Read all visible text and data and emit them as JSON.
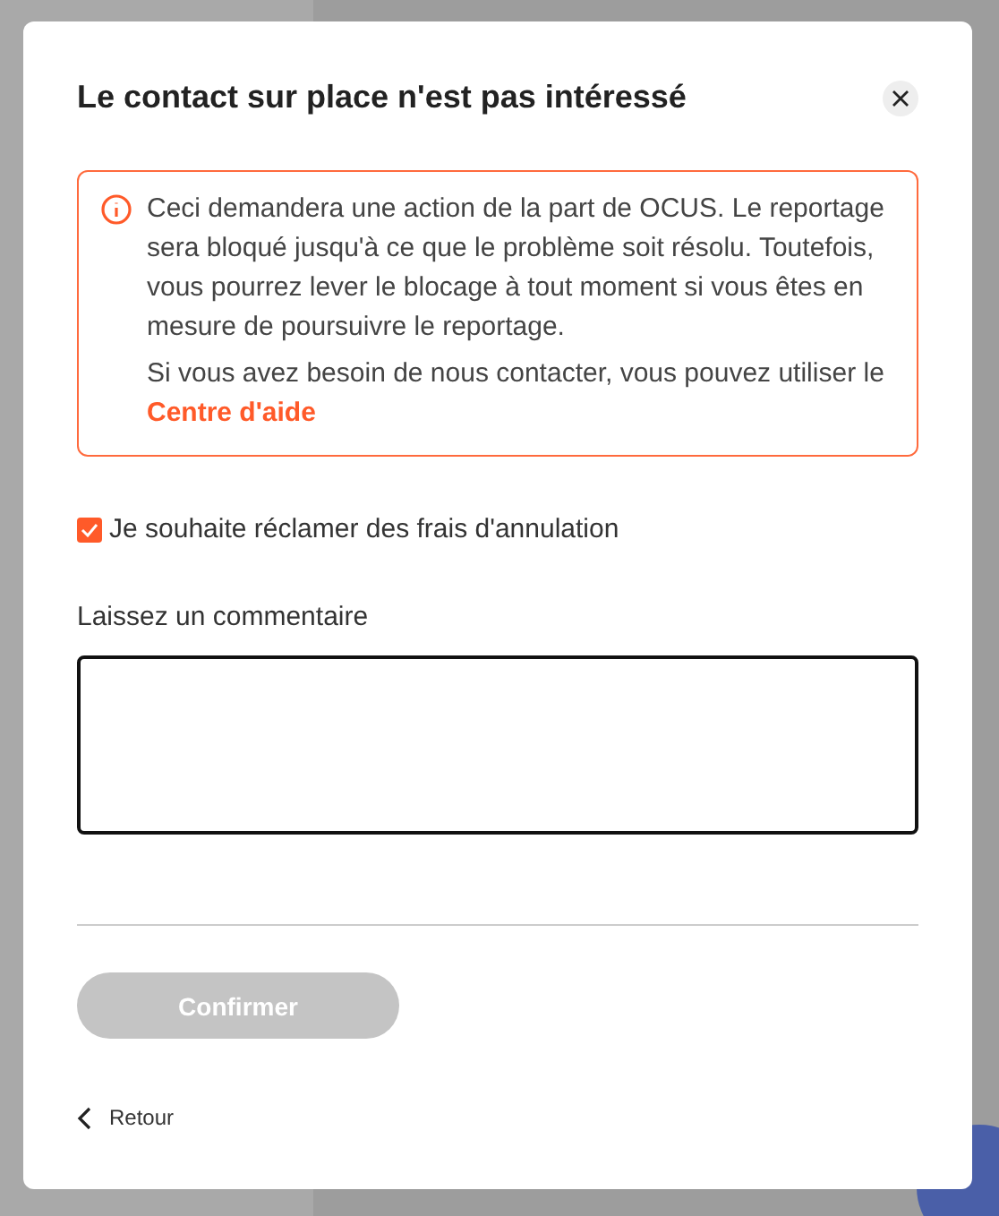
{
  "dialog": {
    "title": "Le contact sur place n'est pas intéressé",
    "alert": {
      "lines": [
        "Ceci demandera une action de la part de OCUS. Le reportage sera bloqué jusqu'à ce que le problème soit résolu. Toutefois, vous pourrez lever le blocage à tout moment si vous êtes en mesure de poursuivre le reportage.",
        "Si vous avez besoin de nous contacter, vous pouvez utiliser le"
      ],
      "link": "Centre d'aide"
    },
    "checkbox": {
      "label": "Je souhaite réclamer des frais d'annulation",
      "checked": true
    },
    "comment": {
      "label": "Laissez un commentaire"
    },
    "confirm": {
      "label": "Confirmer",
      "disabled": true
    },
    "back": {
      "label": "Retour"
    }
  }
}
